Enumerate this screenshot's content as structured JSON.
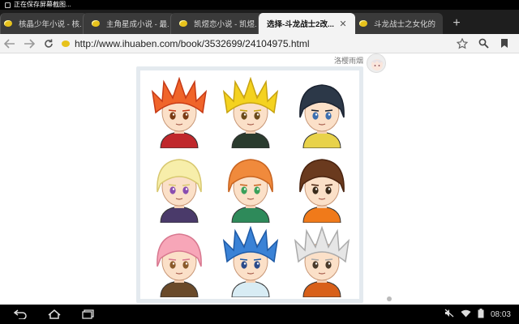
{
  "status_bar": {
    "notification_text": "正在保存屏幕截图..."
  },
  "tabs": [
    {
      "title": "核晶少年小说 - 核...",
      "active": false
    },
    {
      "title": "主角星成小说 - 最...",
      "active": false
    },
    {
      "title": "凯煜恋小说 - 凯煜...",
      "active": false
    },
    {
      "title": "选择-斗龙战士2改...",
      "active": true
    },
    {
      "title": "斗龙战士之女化的...",
      "active": false
    }
  ],
  "toolbar": {
    "url": "http://www.ihuaben.com/book/3532699/24104975.html",
    "icons": [
      "back-icon",
      "forward-icon",
      "reload-icon",
      "star-icon",
      "search-icon",
      "bookmark-icon"
    ]
  },
  "page": {
    "uploader_name": "洛樱雨烟",
    "characters": [
      {
        "hair": "#f0642a",
        "hair_dark": "#c63a16",
        "eyes": "#7a3b14",
        "shirt": "#c0282c",
        "spiky": true
      },
      {
        "hair": "#f4d21f",
        "hair_dark": "#c7a311",
        "eyes": "#6b4a1a",
        "shirt": "#2a3b2e",
        "spiky": true
      },
      {
        "hair": "#2c3848",
        "hair_dark": "#1a2230",
        "eyes": "#3c6fb0",
        "shirt": "#e8d24a",
        "spiky": false
      },
      {
        "hair": "#f7eeaa",
        "hair_dark": "#d8c870",
        "eyes": "#8a4db0",
        "shirt": "#4a3a6a",
        "spiky": false
      },
      {
        "hair": "#f08a3c",
        "hair_dark": "#c86420",
        "eyes": "#3aa05a",
        "shirt": "#2e8a5a",
        "spiky": false
      },
      {
        "hair": "#6a3a1e",
        "hair_dark": "#4a2410",
        "eyes": "#3a2a1a",
        "shirt": "#f07a1a",
        "spiky": false
      },
      {
        "hair": "#f7a6b8",
        "hair_dark": "#d87890",
        "eyes": "#8a5a2a",
        "shirt": "#6a4a2a",
        "spiky": false
      },
      {
        "hair": "#3a82d6",
        "hair_dark": "#1e5aa6",
        "eyes": "#2a4a8a",
        "shirt": "#d8ecf4",
        "spiky": true
      },
      {
        "hair": "#e6e6e6",
        "hair_dark": "#aaaaaa",
        "eyes": "#4a3a2a",
        "shirt": "#d8601a",
        "spiky": true
      }
    ]
  },
  "nav_bar": {
    "time": "08:03"
  }
}
